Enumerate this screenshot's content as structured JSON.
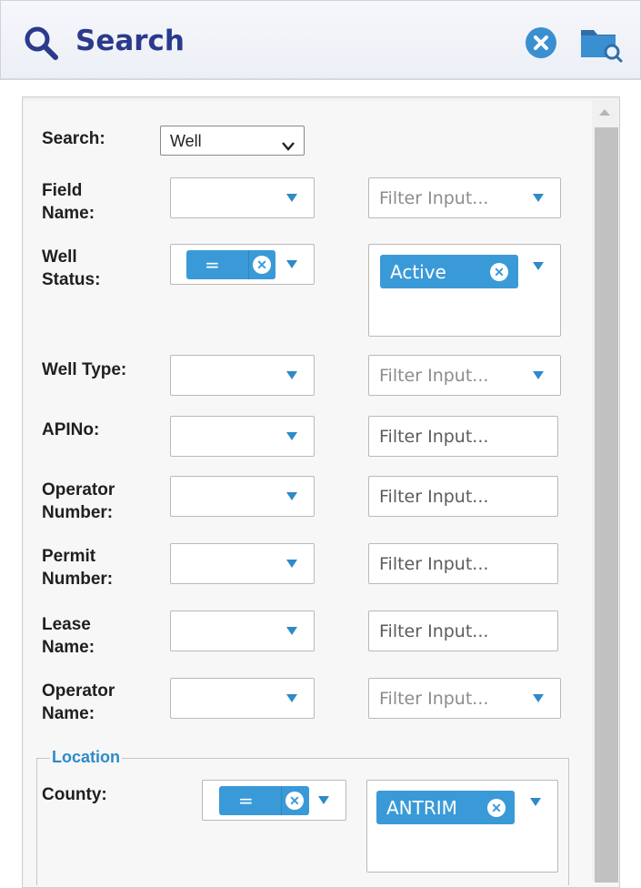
{
  "header": {
    "title": "Search",
    "search_icon": "magnifier-icon",
    "close_icon": "close-circle-icon",
    "folder_icon": "folder-search-icon"
  },
  "form": {
    "search_label": "Search:",
    "search_value": "Well",
    "fields": {
      "field_name": {
        "label_1": "Field",
        "label_2": "Name:",
        "filter_placeholder": "Filter Input..."
      },
      "well_status": {
        "label_1": "Well",
        "label_2": "Status:",
        "operator": "=",
        "value_tag": "Active"
      },
      "well_type": {
        "label": "Well Type:",
        "filter_placeholder": "Filter Input..."
      },
      "apino": {
        "label": "APINo:",
        "filter_placeholder": "Filter Input..."
      },
      "operator_number": {
        "label_1": "Operator",
        "label_2": "Number:",
        "filter_placeholder": "Filter Input..."
      },
      "permit_number": {
        "label_1": "Permit",
        "label_2": "Number:",
        "filter_placeholder": "Filter Input..."
      },
      "lease_name": {
        "label_1": "Lease",
        "label_2": "Name:",
        "filter_placeholder": "Filter Input..."
      },
      "operator_name": {
        "label_1": "Operator",
        "label_2": "Name:",
        "filter_placeholder": "Filter Input..."
      }
    },
    "location": {
      "legend": "Location",
      "county_label": "County:",
      "operator": "=",
      "value_tag": "ANTRIM"
    }
  },
  "colors": {
    "accent": "#3a9ad8",
    "title": "#2a3a8c",
    "legend": "#2e8ac8"
  }
}
